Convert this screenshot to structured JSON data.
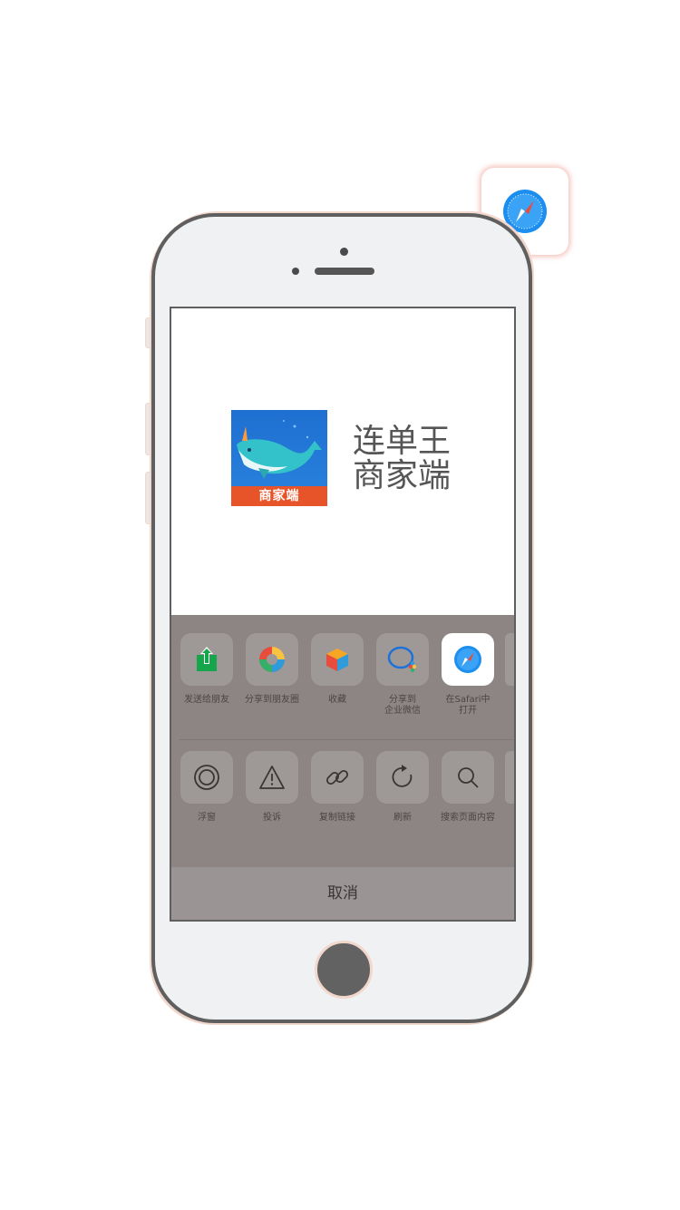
{
  "app": {
    "name_line1": "连单王",
    "name_line2": "商家端",
    "icon_banner": "商家端",
    "icon": "whale-app-icon"
  },
  "share_row": [
    {
      "label": "发送给朋友",
      "icon": "share-send-icon"
    },
    {
      "label": "分享到朋友圈",
      "icon": "moments-icon"
    },
    {
      "label": "收藏",
      "icon": "favorite-cube-icon"
    },
    {
      "label": "分享到\n企业微信",
      "icon": "wework-icon"
    },
    {
      "label": "在Safari中\n打开",
      "icon": "safari-icon"
    }
  ],
  "action_row": [
    {
      "label": "浮窗",
      "icon": "float-window-icon"
    },
    {
      "label": "投诉",
      "icon": "warning-icon"
    },
    {
      "label": "复制链接",
      "icon": "link-icon"
    },
    {
      "label": "刷新",
      "icon": "refresh-icon"
    },
    {
      "label": "搜索页面内容",
      "icon": "search-icon"
    }
  ],
  "cancel_label": "取消",
  "colors": {
    "sheet_bg": "#8c8584",
    "accent_glow": "#ec8c82",
    "safari_blue": "#1c8ef0",
    "banner_orange": "#e8542a"
  }
}
